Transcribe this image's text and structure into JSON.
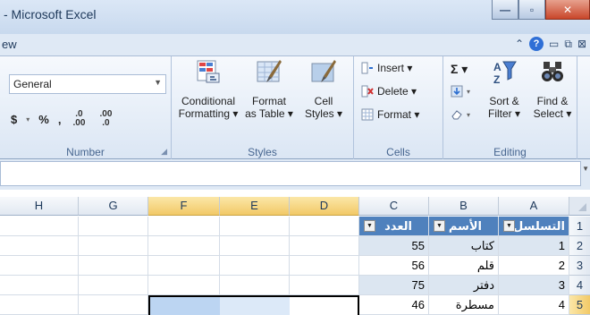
{
  "window": {
    "title": "- Microsoft Excel",
    "tab_partial": "ew"
  },
  "ribbon": {
    "number": {
      "label": "Number",
      "format_value": "General",
      "currency": "$",
      "percent": "%",
      "comma": ",",
      "inc_decimal": ".0 .00",
      "dec_decimal": ".00 .0"
    },
    "styles": {
      "label": "Styles",
      "conditional_formatting": [
        "Conditional",
        "Formatting ▾"
      ],
      "format_as_table": [
        "Format",
        "as Table ▾"
      ],
      "cell_styles": [
        "Cell",
        "Styles ▾"
      ]
    },
    "cells": {
      "label": "Cells",
      "insert": "Insert ▾",
      "delete": "Delete ▾",
      "format": "Format ▾"
    },
    "editing": {
      "label": "Editing",
      "sum": "Σ ▾",
      "sort_filter": [
        "Sort &",
        "Filter ▾"
      ],
      "find_select": [
        "Find &",
        "Select ▾"
      ]
    }
  },
  "grid": {
    "columns": [
      "H",
      "G",
      "F",
      "E",
      "D",
      "C",
      "B",
      "A"
    ],
    "rows": [
      "1",
      "2",
      "3",
      "4",
      "5"
    ],
    "header": {
      "a": "التسلسل",
      "b": "الأسم",
      "c": "العدد"
    },
    "data": [
      {
        "a": "1",
        "b": "كتاب",
        "c": "55"
      },
      {
        "a": "2",
        "b": "قلم",
        "c": "56"
      },
      {
        "a": "3",
        "b": "دفتر",
        "c": "75"
      },
      {
        "a": "4",
        "b": "مسطرة",
        "c": "46"
      }
    ]
  },
  "colors": {
    "table_header": "#4f81bd",
    "band": "#dce6f1",
    "selection_header": "#f2c967"
  }
}
